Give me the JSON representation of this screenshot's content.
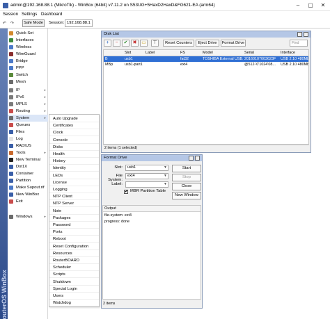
{
  "window": {
    "title": "admin@192.168.88.1 (MikroTik) - WinBox (64bit) v7.11.2 on S53UG+5HaxD2HaxD&FG621-EA (arm64)"
  },
  "menubar": {
    "items": [
      "Session",
      "Settings",
      "Dashboard"
    ]
  },
  "toolbar": {
    "undo": "↶",
    "redo": "↷",
    "safe_mode": "Safe Mode",
    "session_label": "Session:",
    "session_value": "192.168.88.1"
  },
  "sidebar": {
    "brand": "RouterOS WinBox",
    "items": [
      {
        "label": "Quick Set",
        "icon": "quick-set-icon",
        "color": "#d38a2e",
        "arrow": ""
      },
      {
        "label": "Interfaces",
        "icon": "interfaces-icon",
        "color": "#3c8a3c",
        "arrow": ""
      },
      {
        "label": "Wireless",
        "icon": "wireless-icon",
        "color": "#4c7ac9",
        "arrow": ""
      },
      {
        "label": "WireGuard",
        "icon": "wireguard-icon",
        "color": "#8a2e2e",
        "arrow": ""
      },
      {
        "label": "Bridge",
        "icon": "bridge-icon",
        "color": "#4c7ac9",
        "arrow": ""
      },
      {
        "label": "PPP",
        "icon": "ppp-icon",
        "color": "#4c7ac9",
        "arrow": ""
      },
      {
        "label": "Switch",
        "icon": "switch-icon",
        "color": "#5a8a3c",
        "arrow": ""
      },
      {
        "label": "Mesh",
        "icon": "mesh-icon",
        "color": "#6b6b6b",
        "arrow": ""
      },
      {
        "label": "IP",
        "icon": "ip-icon",
        "color": "#7a7a7a",
        "arrow": "▸"
      },
      {
        "label": "IPv6",
        "icon": "ipv6-icon",
        "color": "#7a7a7a",
        "arrow": "▸"
      },
      {
        "label": "MPLS",
        "icon": "mpls-icon",
        "color": "#7a7a7a",
        "arrow": "▸"
      },
      {
        "label": "Routing",
        "icon": "routing-icon",
        "color": "#c94c4c",
        "arrow": "▸"
      },
      {
        "label": "System",
        "icon": "system-icon",
        "color": "#6b6b6b",
        "arrow": "▸"
      },
      {
        "label": "Queues",
        "icon": "queues-icon",
        "color": "#c94c4c",
        "arrow": ""
      },
      {
        "label": "Files",
        "icon": "files-icon",
        "color": "#3a5fa8",
        "arrow": ""
      },
      {
        "label": "Log",
        "icon": "log-icon",
        "color": "#e4e4e4",
        "arrow": ""
      },
      {
        "label": "RADIUS",
        "icon": "radius-icon",
        "color": "#3a5fa8",
        "arrow": ""
      },
      {
        "label": "Tools",
        "icon": "tools-icon",
        "color": "#c96a2e",
        "arrow": "▸"
      },
      {
        "label": "New Terminal",
        "icon": "terminal-icon",
        "color": "#222222",
        "arrow": ""
      },
      {
        "label": "Dot1X",
        "icon": "dot1x-icon",
        "color": "#3a5fa8",
        "arrow": ""
      },
      {
        "label": "Container",
        "icon": "container-icon",
        "color": "#3a5fa8",
        "arrow": ""
      },
      {
        "label": "Partition",
        "icon": "partition-icon",
        "color": "#3a5fa8",
        "arrow": ""
      },
      {
        "label": "Make Supout.rif",
        "icon": "supout-icon",
        "color": "#4c7ac9",
        "arrow": ""
      },
      {
        "label": "New WinBox",
        "icon": "winbox-icon",
        "color": "#3a5fa8",
        "arrow": ""
      },
      {
        "label": "Exit",
        "icon": "exit-icon",
        "color": "#c94c4c",
        "arrow": ""
      },
      {
        "label": "Windows",
        "icon": "windows-icon",
        "color": "#6b6b6b",
        "arrow": "▸"
      }
    ]
  },
  "system_menu": {
    "items": [
      "Auto Upgrade",
      "Certificates",
      "Clock",
      "Console",
      "Disks",
      "Health",
      "History",
      "Identity",
      "LEDs",
      "License",
      "Logging",
      "NTP Client",
      "NTP Server",
      "Note",
      "Packages",
      "Password",
      "Ports",
      "Reboot",
      "Reset Configuration",
      "Resources",
      "RouterBOARD",
      "Scheduler",
      "Scripts",
      "Shutdown",
      "Special Login",
      "Users",
      "Watchdog"
    ]
  },
  "disk_list": {
    "title": "Disk List",
    "toolbar": {
      "add": "+",
      "remove": "−",
      "enable": "✔",
      "disable": "✖",
      "comment": "▭",
      "filter": "⊤",
      "reset_counters": "Reset Counters",
      "eject_drive": "Eject Drive",
      "format_drive": "Format Drive",
      "find_placeholder": "Find"
    },
    "columns": [
      "",
      "Slot",
      "Label",
      "FS",
      "Model",
      "Serial",
      "Interface"
    ],
    "rows": [
      [
        "B",
        "usb1",
        "",
        "fat32",
        "TOSHIBA External USB...",
        "20160107003623F",
        "USB 2.10 480Mbps"
      ],
      [
        "MBp",
        "usb1-part1",
        "",
        "ext4",
        "",
        "@512-'0'1024'08...",
        "USB 2.10 480Mbps"
      ]
    ],
    "status": "2 items (1 selected)"
  },
  "format_drive": {
    "title": "Format Drive",
    "slot_label": "Slot:",
    "slot_value": "usb1",
    "fs_label": "File System:",
    "fs_value": "ext4",
    "label_label": "Label:",
    "label_value": "",
    "mbr_checked": "✔",
    "mbr_label": "MBR Partition Table",
    "buttons": {
      "start": "Start",
      "stop": "Stop",
      "close": "Close",
      "new_window": "New Window"
    },
    "output_header": "Output",
    "output_rows": [
      "file-system: ext4",
      "progress: done"
    ],
    "status": "2 items"
  }
}
